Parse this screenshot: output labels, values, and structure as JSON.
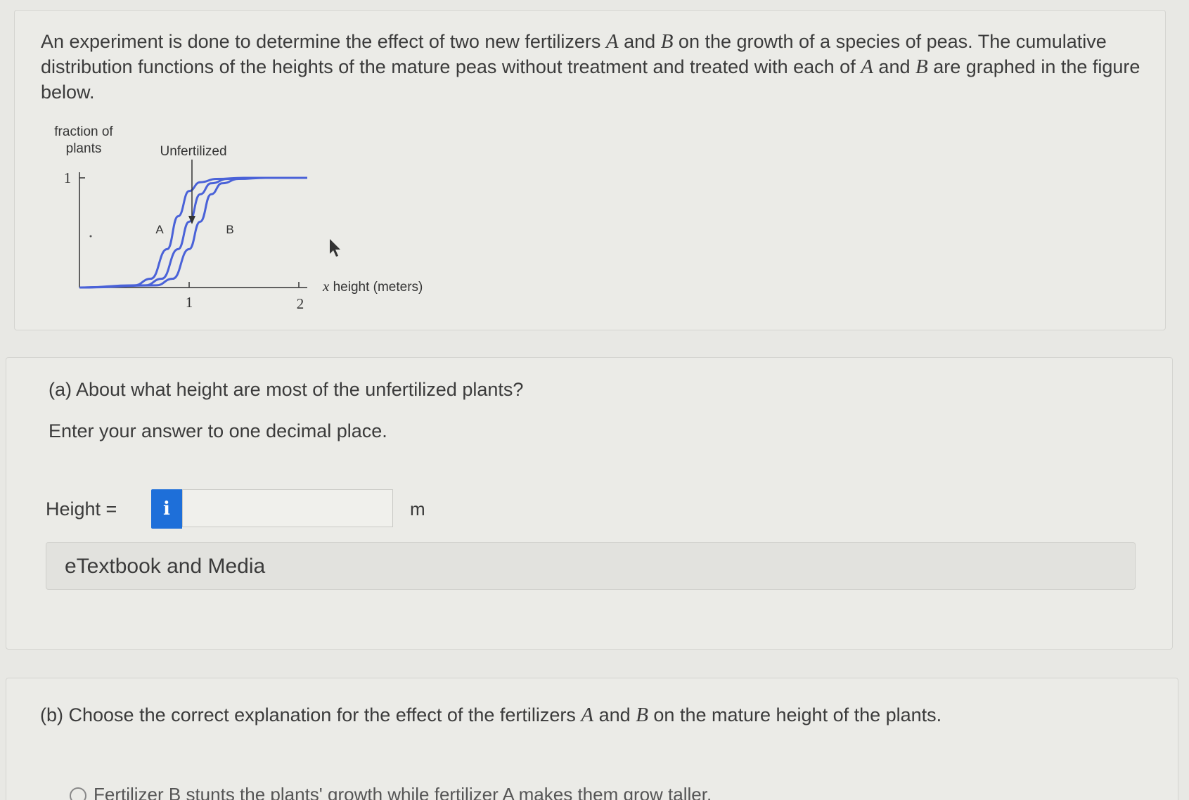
{
  "problem": {
    "intro_1": "An experiment is done to determine the effect of two new fertilizers ",
    "var_a": "A",
    "intro_2": " and ",
    "var_b": "B",
    "intro_3": " on the growth of a species of peas. The cumulative distribution functions of the heights of the mature peas without treatment and treated with each of ",
    "intro_4": " and ",
    "intro_5": " are graphed in the figure below."
  },
  "figure": {
    "ylabel_line1": "fraction of",
    "ylabel_line2": "plants",
    "y_tick_1": "1",
    "unfertilized_label": "Unfertilized",
    "curve_a_label": "A",
    "curve_b_label": "B",
    "x_tick_1": "1",
    "x_tick_2": "2",
    "x_var": "x",
    "xlabel": " height (meters)"
  },
  "chart_data": {
    "type": "line",
    "xlabel": "x height (meters)",
    "ylabel": "fraction of plants",
    "xlim": [
      0,
      2
    ],
    "ylim": [
      0,
      1
    ],
    "series": [
      {
        "name": "A",
        "x": [
          0,
          0.5,
          0.65,
          0.8,
          0.9,
          1.0,
          1.1,
          1.25,
          1.5,
          2.0
        ],
        "y": [
          0,
          0.02,
          0.08,
          0.35,
          0.65,
          0.88,
          0.96,
          0.99,
          1.0,
          1.0
        ]
      },
      {
        "name": "Unfertilized",
        "x": [
          0,
          0.6,
          0.75,
          0.9,
          1.0,
          1.1,
          1.2,
          1.35,
          1.6,
          2.0
        ],
        "y": [
          0,
          0.02,
          0.08,
          0.35,
          0.6,
          0.85,
          0.95,
          0.99,
          1.0,
          1.0
        ]
      },
      {
        "name": "B",
        "x": [
          0,
          0.7,
          0.85,
          1.0,
          1.1,
          1.2,
          1.3,
          1.45,
          1.7,
          2.0
        ],
        "y": [
          0,
          0.02,
          0.08,
          0.35,
          0.6,
          0.85,
          0.95,
          0.99,
          1.0,
          1.0
        ]
      }
    ]
  },
  "part_a": {
    "question": "(a) About what height are most of the unfertilized plants?",
    "instruction": "Enter your answer to one decimal place.",
    "height_label": "Height =",
    "info_icon": "i",
    "input_value": "",
    "unit": "m",
    "etextbook": "eTextbook and Media"
  },
  "part_b": {
    "question_1": "(b) Choose the correct explanation for the effect of the fertilizers ",
    "question_2": " and ",
    "question_3": " on the mature height of the plants.",
    "option_1": "Fertilizer B stunts the plants' growth while fertilizer A makes them grow taller."
  },
  "colors": {
    "curve": "#4a62d8",
    "info_button": "#1e6fd9"
  }
}
